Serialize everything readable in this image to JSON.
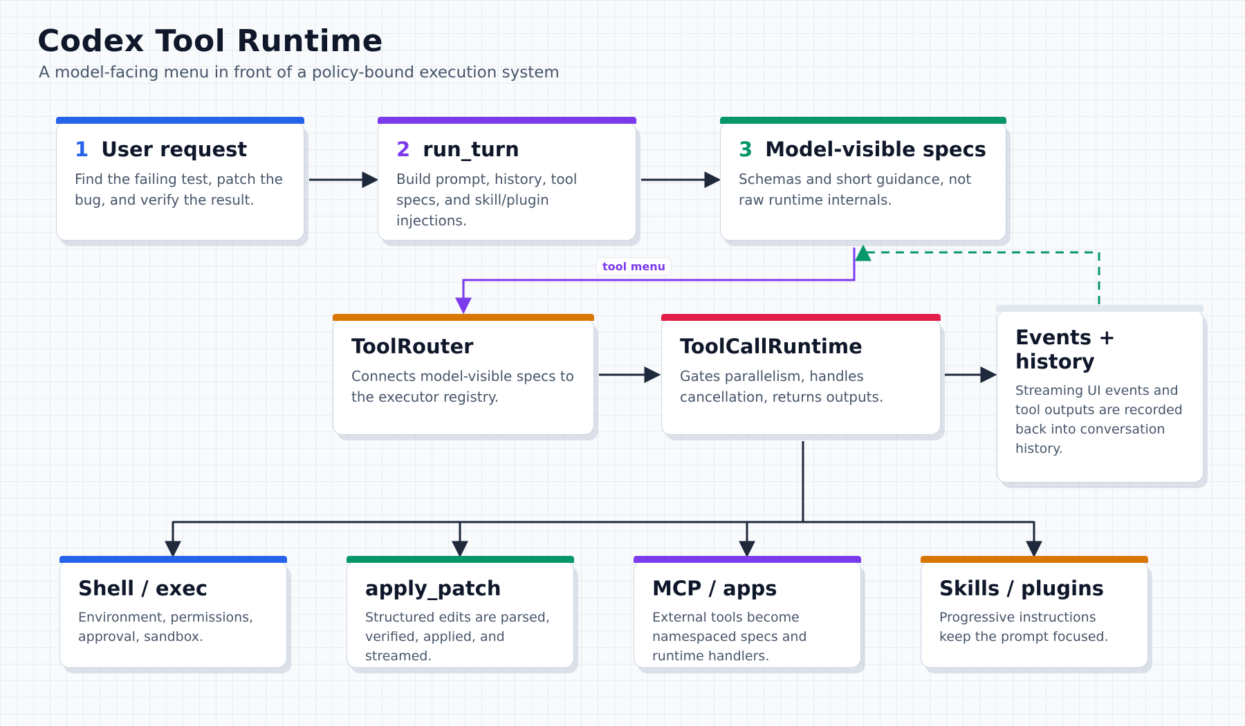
{
  "title": "Codex Tool Runtime",
  "subtitle": "A model-facing menu in front of a policy-bound execution system",
  "colors": {
    "blue": "#2563eb",
    "purple": "#7c3aed",
    "green": "#059669",
    "orange": "#d97706",
    "red": "#e11d48",
    "gray": "#e2e8f0",
    "ink": "#1e293b"
  },
  "nodes": {
    "user_request": {
      "num": "1",
      "title": "User request",
      "desc": "Find the failing test, patch the bug, and verify the result."
    },
    "run_turn": {
      "num": "2",
      "title": "run_turn",
      "desc": "Build prompt, history, tool specs, and skill/plugin injections."
    },
    "model_specs": {
      "num": "3",
      "title": "Model-visible specs",
      "desc": "Schemas and short guidance, not raw runtime internals."
    },
    "tool_router": {
      "title": "ToolRouter",
      "desc": "Connects model-visible specs to the executor registry."
    },
    "tool_call_runtime": {
      "title": "ToolCallRuntime",
      "desc": "Gates parallelism, handles cancellation, returns outputs."
    },
    "events_history": {
      "title": "Events + history",
      "desc": "Streaming UI events and tool outputs are recorded back into conversation history."
    },
    "shell_exec": {
      "title": "Shell / exec",
      "desc": "Environment, permissions, approval, sandbox."
    },
    "apply_patch": {
      "title": "apply_patch",
      "desc": "Structured edits are parsed, verified, applied, and streamed."
    },
    "mcp_apps": {
      "title": "MCP / apps",
      "desc": "External tools become namespaced specs and runtime handlers."
    },
    "skills_plugins": {
      "title": "Skills / plugins",
      "desc": "Progressive instructions keep the prompt focused."
    }
  },
  "edge_labels": {
    "tool_menu": "tool menu"
  }
}
